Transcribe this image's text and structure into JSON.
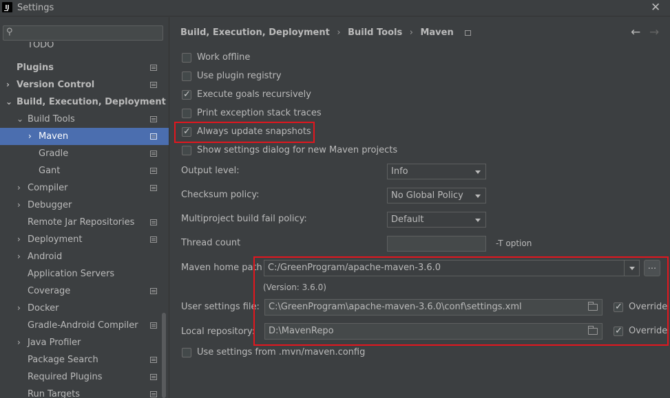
{
  "window": {
    "title": "Settings",
    "app_icon_text": "IJ",
    "close_glyph": "✕"
  },
  "sidebar": {
    "items": [
      {
        "label": "TODO"
      },
      {
        "label": "Plugins"
      },
      {
        "label": "Version Control",
        "arrow": "›"
      },
      {
        "label": "Build, Execution, Deployment",
        "arrow": "⌄"
      },
      {
        "label": "Build Tools",
        "arrow": "⌄"
      },
      {
        "label": "Maven",
        "arrow": "›"
      },
      {
        "label": "Gradle"
      },
      {
        "label": "Gant"
      },
      {
        "label": "Compiler",
        "arrow": "›"
      },
      {
        "label": "Debugger",
        "arrow": "›"
      },
      {
        "label": "Remote Jar Repositories"
      },
      {
        "label": "Deployment",
        "arrow": "›"
      },
      {
        "label": "Android",
        "arrow": "›"
      },
      {
        "label": "Application Servers"
      },
      {
        "label": "Coverage"
      },
      {
        "label": "Docker",
        "arrow": "›"
      },
      {
        "label": "Gradle-Android Compiler"
      },
      {
        "label": "Java Profiler",
        "arrow": "›"
      },
      {
        "label": "Package Search"
      },
      {
        "label": "Required Plugins"
      },
      {
        "label": "Run Targets"
      }
    ]
  },
  "breadcrumb": {
    "items": [
      "Build, Execution, Deployment",
      "Build Tools",
      "Maven"
    ],
    "separator": "›",
    "back_glyph": "←",
    "forward_glyph": "→"
  },
  "options": [
    {
      "label": "Work offline",
      "checked": false
    },
    {
      "label": "Use plugin registry",
      "checked": false
    },
    {
      "label": "Execute goals recursively",
      "checked": true
    },
    {
      "label": "Print exception stack traces",
      "checked": false
    },
    {
      "label": "Always update snapshots",
      "checked": true
    },
    {
      "label": "Show settings dialog for new Maven projects",
      "checked": false
    }
  ],
  "fields": {
    "output_level": {
      "label": "Output level:",
      "value": "Info"
    },
    "checksum_policy": {
      "label": "Checksum policy:",
      "value": "No Global Policy"
    },
    "fail_policy": {
      "label": "Multiproject build fail policy:",
      "value": "Default"
    },
    "thread_count": {
      "label": "Thread count",
      "value": "",
      "hint": "-T option"
    },
    "maven_home": {
      "label": "Maven home path",
      "value": "C:/GreenProgram/apache-maven-3.6.0",
      "version": "(Version: 3.6.0)",
      "browse": "..."
    },
    "user_settings": {
      "label": "User settings file:",
      "value": "C:\\GreenProgram\\apache-maven-3.6.0\\conf\\settings.xml",
      "override_label": "Override",
      "override": true
    },
    "local_repo": {
      "label": "Local repository:",
      "value": "D:\\MavenRepo",
      "override_label": "Override",
      "override": true
    }
  },
  "mvn_config": {
    "label": "Use settings from .mvn/maven.config",
    "checked": false
  },
  "colors": {
    "accent": "#4b6eaf",
    "highlight": "#e3161e",
    "background": "#3c3f41"
  }
}
